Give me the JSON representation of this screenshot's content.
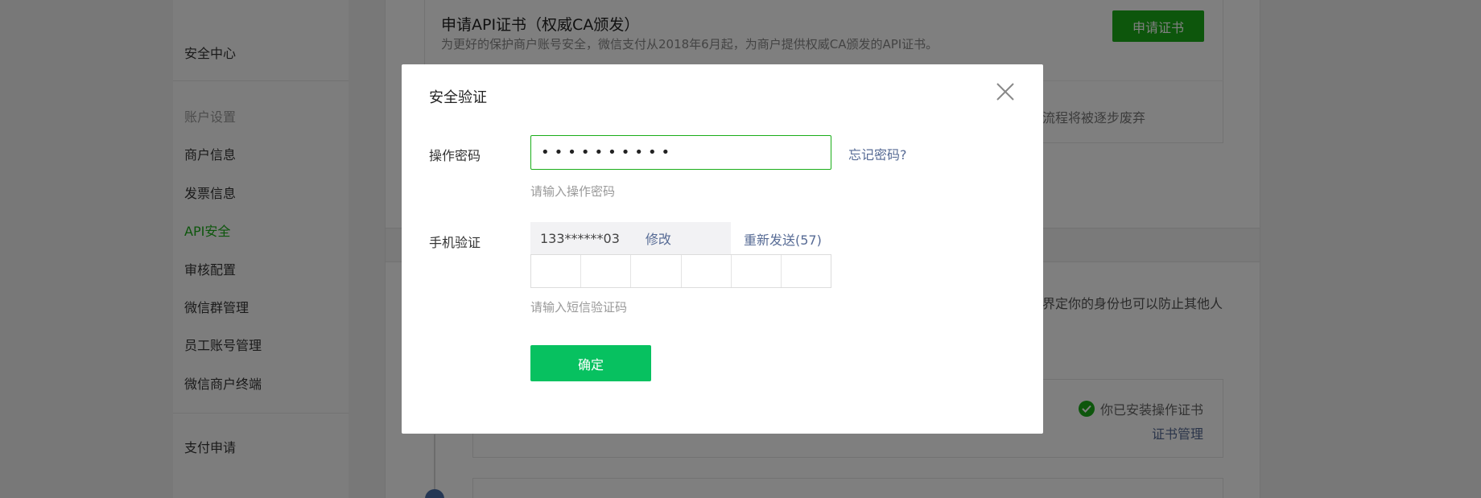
{
  "sidebar": {
    "items": [
      {
        "label": "安全中心",
        "state": "normal"
      },
      {
        "label": "账户设置",
        "state": "muted"
      },
      {
        "label": "商户信息",
        "state": "normal"
      },
      {
        "label": "发票信息",
        "state": "normal"
      },
      {
        "label": "API安全",
        "state": "active"
      },
      {
        "label": "审核配置",
        "state": "normal"
      },
      {
        "label": "微信群管理",
        "state": "normal"
      },
      {
        "label": "员工账号管理",
        "state": "normal"
      },
      {
        "label": "微信商户终端",
        "state": "normal"
      },
      {
        "label": "支付申请",
        "state": "normal"
      }
    ]
  },
  "background": {
    "api_cert_title": "申请API证书（权威CA颁发）",
    "api_cert_desc": "为更好的保护商户账号安全，微信支付从2018年6月起，为商户提供权威CA颁发的API证书。",
    "apply_button": "申请证书",
    "note_fragment_1": "流程将被逐步废弃",
    "note_fragment_2": "界定你的身份也可以防止其他人",
    "installed_text": "你已安装操作证书",
    "cert_manage_link": "证书管理"
  },
  "modal": {
    "title": "安全验证",
    "password_label": "操作密码",
    "password_value": "••••••••••",
    "forgot_link": "忘记密码?",
    "password_hint": "请输入操作密码",
    "phone_label": "手机验证",
    "phone_number": "133******03",
    "edit_link": "修改",
    "resend_link": "重新发送(57)",
    "code_hint": "请输入短信验证码",
    "confirm_button": "确定"
  },
  "colors": {
    "accent_green": "#1aad19",
    "confirm_green": "#07c160",
    "link_blue": "#576b95"
  },
  "icons": {
    "close": "close-icon",
    "check": "check-circle-icon"
  }
}
